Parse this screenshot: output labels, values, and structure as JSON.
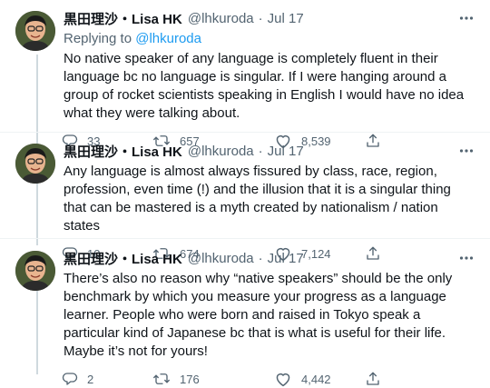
{
  "tweets": [
    {
      "name": "黒田理沙・Lisa HK",
      "handle": "@lhkuroda",
      "dot": "·",
      "date": "Jul 17",
      "replying_prefix": "Replying to ",
      "replying_to": "@lhkuroda",
      "text": "No native speaker of any language is completely fluent in their language bc no language is singular. If I were hanging around a group of rocket scientists speaking in English I would have no idea what they were talking about.",
      "replies": "33",
      "retweets": "657",
      "likes": "8,539"
    },
    {
      "name": "黒田理沙・Lisa HK",
      "handle": "@lhkuroda",
      "dot": "·",
      "date": "Jul 17",
      "text": "Any language is almost always fissured by class, race, region, profession, even time (!) and the illusion that it is a singular thing that can be mastered is a myth created by nationalism / nation states",
      "replies": "10",
      "retweets": "674",
      "likes": "7,124"
    },
    {
      "name": "黒田理沙・Lisa HK",
      "handle": "@lhkuroda",
      "dot": "·",
      "date": "Jul 17",
      "text": "There’s also no reason why “native speakers” should be the only benchmark by which you measure your progress as a language learner. People who were born and raised in Tokyo speak a particular kind of Japanese bc that is what is useful for their life. Maybe it’s not for yours!",
      "replies": "2",
      "retweets": "176",
      "likes": "4,442"
    }
  ],
  "icons": {
    "reply": "reply-icon",
    "retweet": "retweet-icon",
    "like": "heart-icon",
    "share": "share-icon",
    "more": "more-icon"
  },
  "colors": {
    "text": "#0f1419",
    "secondary": "#536471",
    "accent": "#1d9bf0",
    "thread_line": "#cfd9de"
  }
}
